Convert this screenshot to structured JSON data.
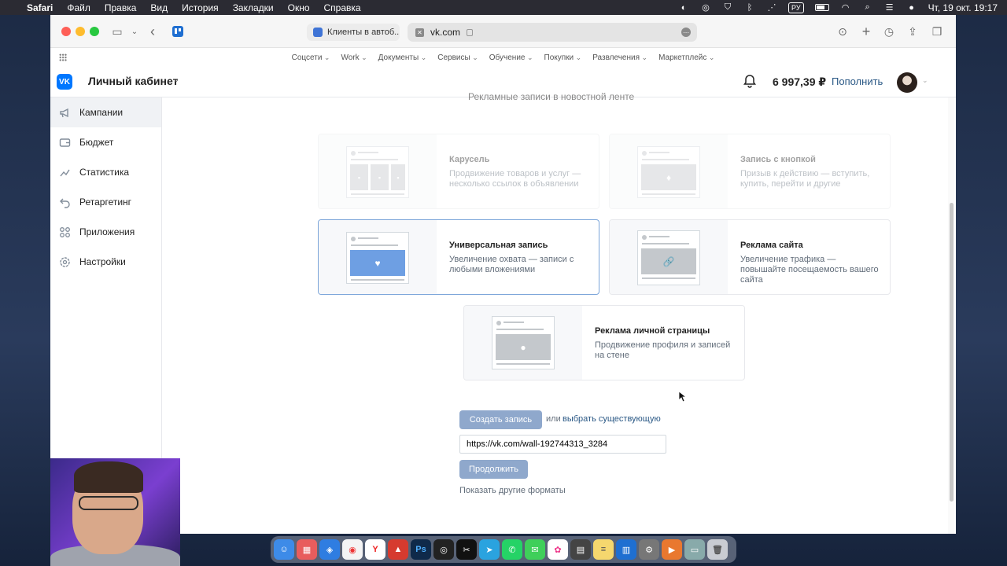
{
  "menubar": {
    "app_name": "Safari",
    "items": [
      "Файл",
      "Правка",
      "Вид",
      "История",
      "Закладки",
      "Окно",
      "Справка"
    ],
    "input_lang": "РУ",
    "datetime": "Чт, 19 окт.  19:17"
  },
  "browser": {
    "tab_inactive_title": "Клиенты в автоб...",
    "address": "vk.com",
    "bookmarks": [
      "Соцсети",
      "Work",
      "Документы",
      "Сервисы",
      "Обучение",
      "Покупки",
      "Развлечения",
      "Маркетплейс"
    ]
  },
  "header": {
    "logo": "VK",
    "cabinet_title": "Личный кабинет",
    "balance": "6 997,39 ₽",
    "topup_label": "Пополнить"
  },
  "sidebar": {
    "items": [
      {
        "label": "Кампании",
        "icon": "megaphone-icon"
      },
      {
        "label": "Бюджет",
        "icon": "wallet-icon"
      },
      {
        "label": "Статистика",
        "icon": "chart-icon"
      },
      {
        "label": "Ретаргетинг",
        "icon": "retarget-icon"
      },
      {
        "label": "Приложения",
        "icon": "apps-icon"
      },
      {
        "label": "Настройки",
        "icon": "settings-icon"
      }
    ]
  },
  "main": {
    "section_title_cut": "Рекламные записи в новостной ленте",
    "formats": [
      {
        "title": "Карусель",
        "desc": "Продвижение товаров и услуг — несколько ссылок в объявлении",
        "state": "disabled"
      },
      {
        "title": "Запись с кнопкой",
        "desc": "Призыв к действию — вступить, купить, перейти и другие",
        "state": "disabled"
      },
      {
        "title": "Универсальная запись",
        "desc": "Увеличение охвата — записи с любыми вложениями",
        "state": "selected"
      },
      {
        "title": "Реклама сайта",
        "desc": "Увеличение трафика — повышайте посещаемость вашего сайта",
        "state": "normal"
      },
      {
        "title": "Реклама личной страницы",
        "desc": "Продвижение профиля и записей на стене",
        "state": "normal"
      }
    ],
    "create_post_label": "Создать запись",
    "or_label": "или",
    "choose_existing_label": "выбрать существующую",
    "post_url": "https://vk.com/wall-192744313_3284",
    "continue_label": "Продолжить",
    "other_formats_label": "Показать другие форматы"
  },
  "colors": {
    "vk_blue": "#0077ff",
    "link": "#2a5885",
    "button_disabled": "#8fa8cc",
    "selected_border": "#7aa4d9"
  }
}
